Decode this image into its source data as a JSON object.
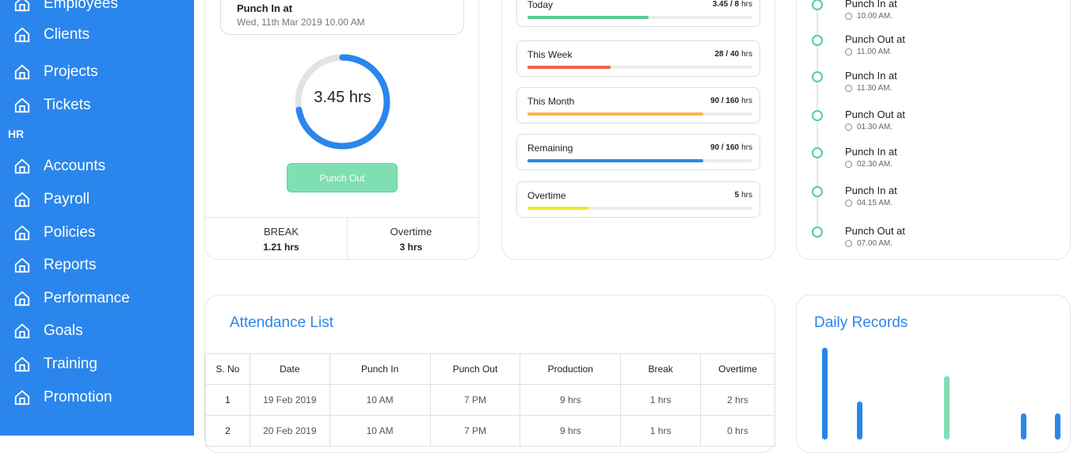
{
  "sidebar": {
    "items_top": [
      {
        "label": "Employees"
      },
      {
        "label": "Clients"
      },
      {
        "label": "Projects"
      },
      {
        "label": "Tickets"
      }
    ],
    "section_hr": "HR",
    "items_hr": [
      {
        "label": "Accounts"
      },
      {
        "label": "Payroll"
      },
      {
        "label": "Policies"
      },
      {
        "label": "Reports"
      },
      {
        "label": "Performance"
      },
      {
        "label": "Goals"
      },
      {
        "label": "Training"
      },
      {
        "label": "Promotion"
      }
    ]
  },
  "timesheet": {
    "punch_in_title": "Punch In at",
    "punch_in_date": "Wed, 11th Mar 2019 10.00 AM",
    "hours": "3.45 hrs",
    "ring_progress": 0.72,
    "punch_out_label": "Punch Out",
    "break_label": "BREAK",
    "break_value": "1.21 hrs",
    "overtime_label": "Overtime",
    "overtime_value": "3 hrs"
  },
  "statistics": [
    {
      "name": "Today",
      "done": "3.45",
      "total": "8",
      "unit": "hrs",
      "progress": 0.54,
      "color": "#55cf95"
    },
    {
      "name": "This Week",
      "done": "28",
      "total": "40",
      "unit": "hrs",
      "progress": 0.37,
      "color": "#f0604a"
    },
    {
      "name": "This Month",
      "done": "90",
      "total": "160",
      "unit": "hrs",
      "progress": 0.78,
      "color": "#fbb450"
    },
    {
      "name": "Remaining",
      "done": "90",
      "total": "160",
      "unit": "hrs",
      "progress": 0.78,
      "color": "#2a86ec"
    },
    {
      "name": "Overtime",
      "done": "5",
      "total": "",
      "unit": "hrs",
      "progress": 0.27,
      "color": "#f0e52a"
    }
  ],
  "activity": [
    {
      "title": "Punch In at",
      "time": "10.00 AM."
    },
    {
      "title": "Punch Out at",
      "time": "11.00 AM."
    },
    {
      "title": "Punch In at",
      "time": "11.30 AM."
    },
    {
      "title": "Punch Out at",
      "time": "01.30 AM."
    },
    {
      "title": "Punch In at",
      "time": "02.30 AM."
    },
    {
      "title": "Punch In at",
      "time": "04.15 AM."
    },
    {
      "title": "Punch Out at",
      "time": "07.00 AM."
    }
  ],
  "attendance": {
    "title": "Attendance List",
    "columns": [
      "S. No",
      "Date",
      "Punch In",
      "Punch Out",
      "Production",
      "Break",
      "Overtime"
    ],
    "rows": [
      [
        "1",
        "19 Feb 2019",
        "10 AM",
        "7 PM",
        "9 hrs",
        "1 hrs",
        "2 hrs"
      ],
      [
        "2",
        "20 Feb 2019",
        "10 AM",
        "7 PM",
        "9 hrs",
        "1 hrs",
        "0 hrs"
      ]
    ]
  },
  "daily_records": {
    "title": "Daily Records",
    "bar_colors": [
      "#2a86ec",
      "#2a86ec",
      "#80dfb2",
      "#2a86ec",
      "#2a86ec"
    ]
  }
}
